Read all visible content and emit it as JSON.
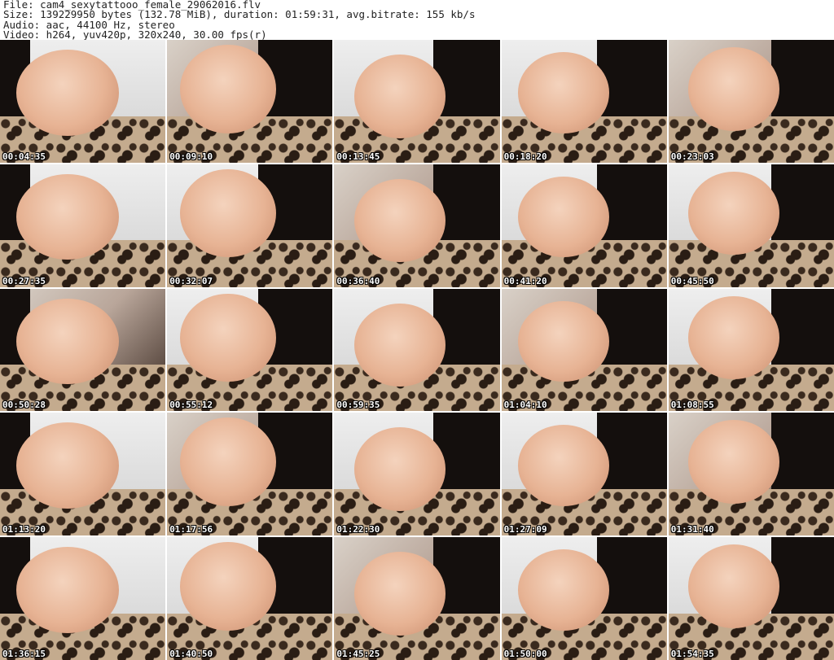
{
  "header": {
    "file": "File: cam4_sexytattooo_female_29062016.flv",
    "size": "Size: 139229950 bytes (132.78 MiB), duration: 01:59:31, avg.bitrate: 155 kb/s",
    "audio": "Audio: aac, 44100 Hz, stereo",
    "video": "Video: h264, yuv420p, 320x240, 30.00 fps(r)"
  },
  "thumbnails": [
    {
      "timestamp": "00:04:35"
    },
    {
      "timestamp": "00:09:10"
    },
    {
      "timestamp": "00:13:45"
    },
    {
      "timestamp": "00:18:20"
    },
    {
      "timestamp": "00:23:03"
    },
    {
      "timestamp": "00:27:35"
    },
    {
      "timestamp": "00:32:07"
    },
    {
      "timestamp": "00:36:40"
    },
    {
      "timestamp": "00:41:20"
    },
    {
      "timestamp": "00:45:50"
    },
    {
      "timestamp": "00:50:28"
    },
    {
      "timestamp": "00:55:12"
    },
    {
      "timestamp": "00:59:35"
    },
    {
      "timestamp": "01:04:10"
    },
    {
      "timestamp": "01:08:55"
    },
    {
      "timestamp": "01:13:20"
    },
    {
      "timestamp": "01:17:56"
    },
    {
      "timestamp": "01:22:30"
    },
    {
      "timestamp": "01:27:09"
    },
    {
      "timestamp": "01:31:40"
    },
    {
      "timestamp": "01:36:15"
    },
    {
      "timestamp": "01:40:50"
    },
    {
      "timestamp": "01:45:25"
    },
    {
      "timestamp": "01:50:00"
    },
    {
      "timestamp": "01:54:35"
    }
  ]
}
